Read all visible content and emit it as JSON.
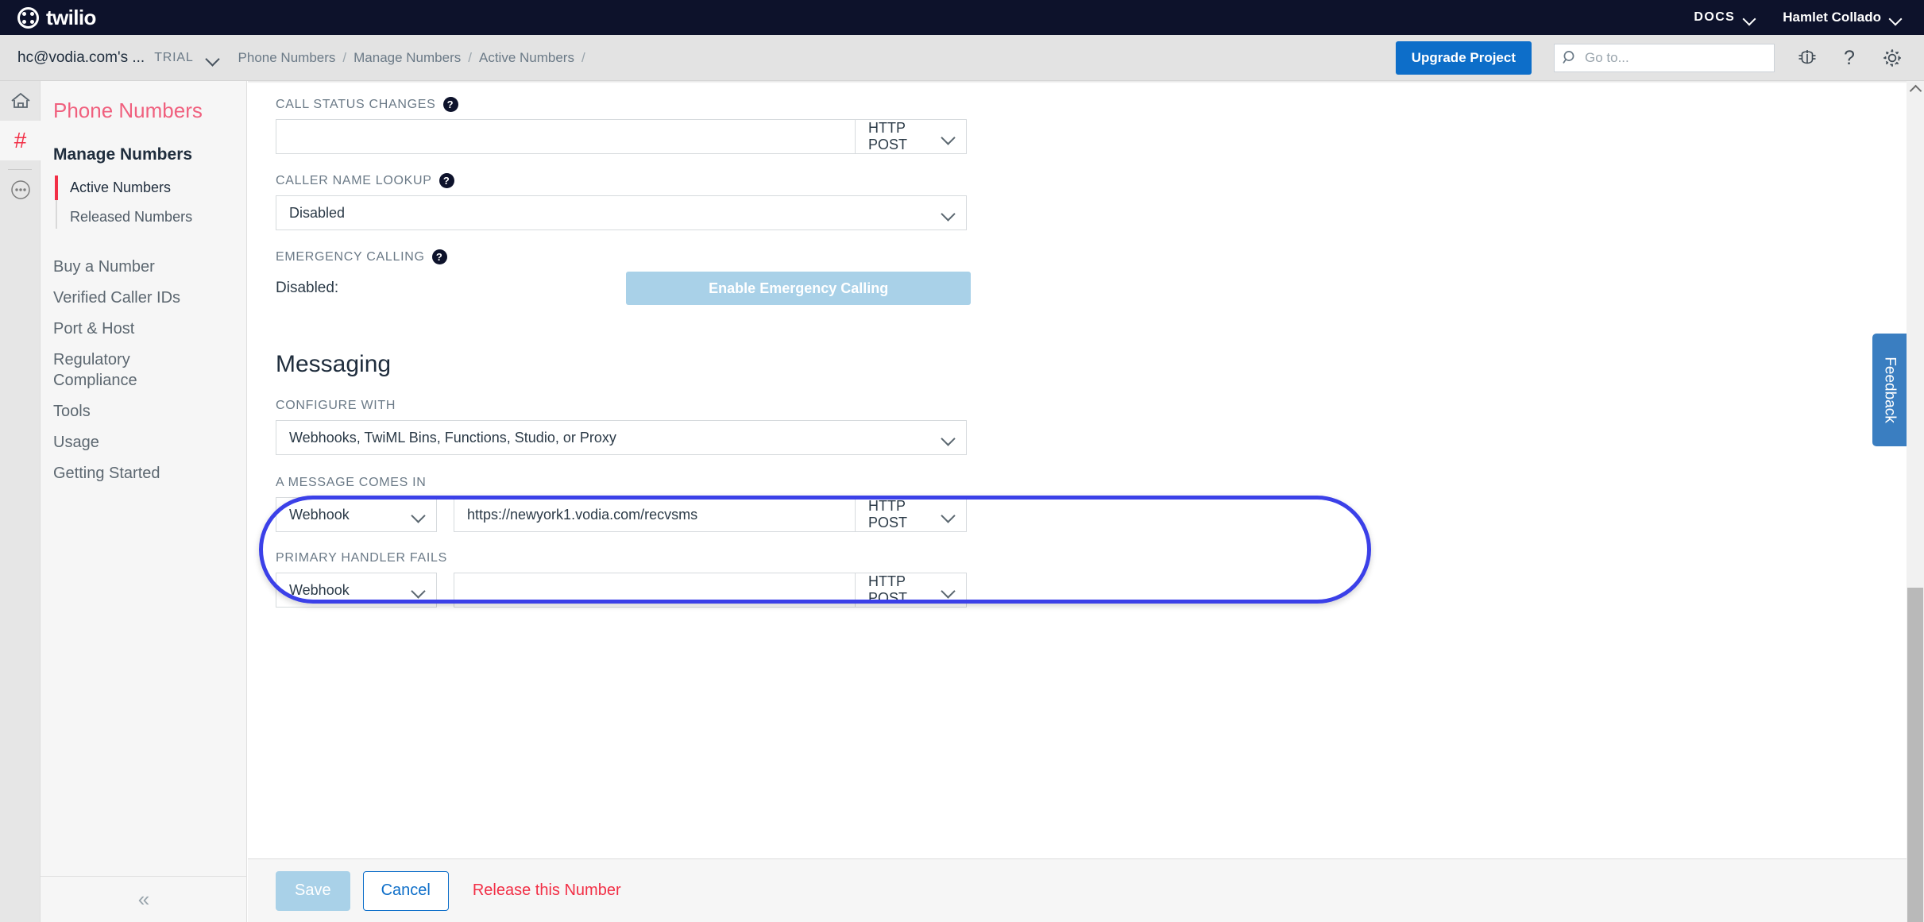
{
  "brand": {
    "name": "twilio",
    "logo_icon": "twilio-logo-icon"
  },
  "topbar": {
    "docs_label": "DOCS",
    "user_label": "Hamlet Collado",
    "docs_chevron_icon": "chevron-down-icon",
    "user_chevron_icon": "chevron-down-icon"
  },
  "subheader": {
    "account_name": "hc@vodia.com's ...",
    "account_tier": "TRIAL",
    "account_chevron_icon": "chevron-down-icon",
    "breadcrumbs": [
      "Phone Numbers",
      "Manage Numbers",
      "Active Numbers",
      ""
    ],
    "separator": "/",
    "upgrade_label": "Upgrade Project",
    "search_placeholder": "Go to...",
    "search_value": "",
    "search_icon": "search-icon",
    "debugger_icon": "bug-icon",
    "help_icon": "question-mark-icon",
    "settings_icon": "gear-icon"
  },
  "rail": {
    "items": [
      {
        "name": "home",
        "icon": "home-icon"
      },
      {
        "name": "phone-numbers",
        "icon": "hash-icon"
      },
      {
        "name": "more",
        "icon": "ellipsis-circle-icon"
      }
    ]
  },
  "sidebar": {
    "title": "Phone Numbers",
    "group_label": "Manage Numbers",
    "sub_items": [
      {
        "label": "Active Numbers",
        "active": true
      },
      {
        "label": "Released Numbers",
        "active": false
      }
    ],
    "items": [
      {
        "label": "Buy a Number"
      },
      {
        "label": "Verified Caller IDs"
      },
      {
        "label": "Port & Host"
      },
      {
        "label": "Regulatory Compliance"
      },
      {
        "label": "Tools"
      },
      {
        "label": "Usage"
      },
      {
        "label": "Getting Started"
      }
    ],
    "collapse_icon": "double-chevron-left-icon",
    "collapse_glyph": "«"
  },
  "voice": {
    "call_status_label": "CALL STATUS CHANGES",
    "call_status_url": "",
    "call_status_method": "HTTP POST",
    "caller_name_label": "CALLER NAME LOOKUP",
    "caller_name_value": "Disabled",
    "emergency_label": "EMERGENCY CALLING",
    "emergency_status": "Disabled:",
    "emergency_button": "Enable Emergency Calling",
    "help_icon": "question-mark-circle-icon",
    "help_glyph": "?"
  },
  "messaging": {
    "heading": "Messaging",
    "configure_with_label": "CONFIGURE WITH",
    "configure_with_value": "Webhooks, TwiML Bins, Functions, Studio, or Proxy",
    "message_comes_in_label": "A MESSAGE COMES IN",
    "message_comes_in_handler": "Webhook",
    "message_comes_in_url": "https://newyork1.vodia.com/recvsms",
    "message_comes_in_method": "HTTP POST",
    "primary_handler_fails_label": "PRIMARY HANDLER FAILS",
    "primary_handler_fails_handler": "Webhook",
    "primary_handler_fails_url": "",
    "primary_handler_fails_method": "HTTP POST"
  },
  "footer": {
    "save_label": "Save",
    "cancel_label": "Cancel",
    "release_label": "Release this Number"
  },
  "feedback": {
    "label": "Feedback"
  },
  "colors": {
    "brand_dark": "#0d122b",
    "accent_red": "#f22f46",
    "link_blue": "#0d6ec9",
    "annotation_blue": "#3b40e8",
    "disabled_blue": "#a9d1e8",
    "feedback_blue": "#3a7ec1"
  }
}
